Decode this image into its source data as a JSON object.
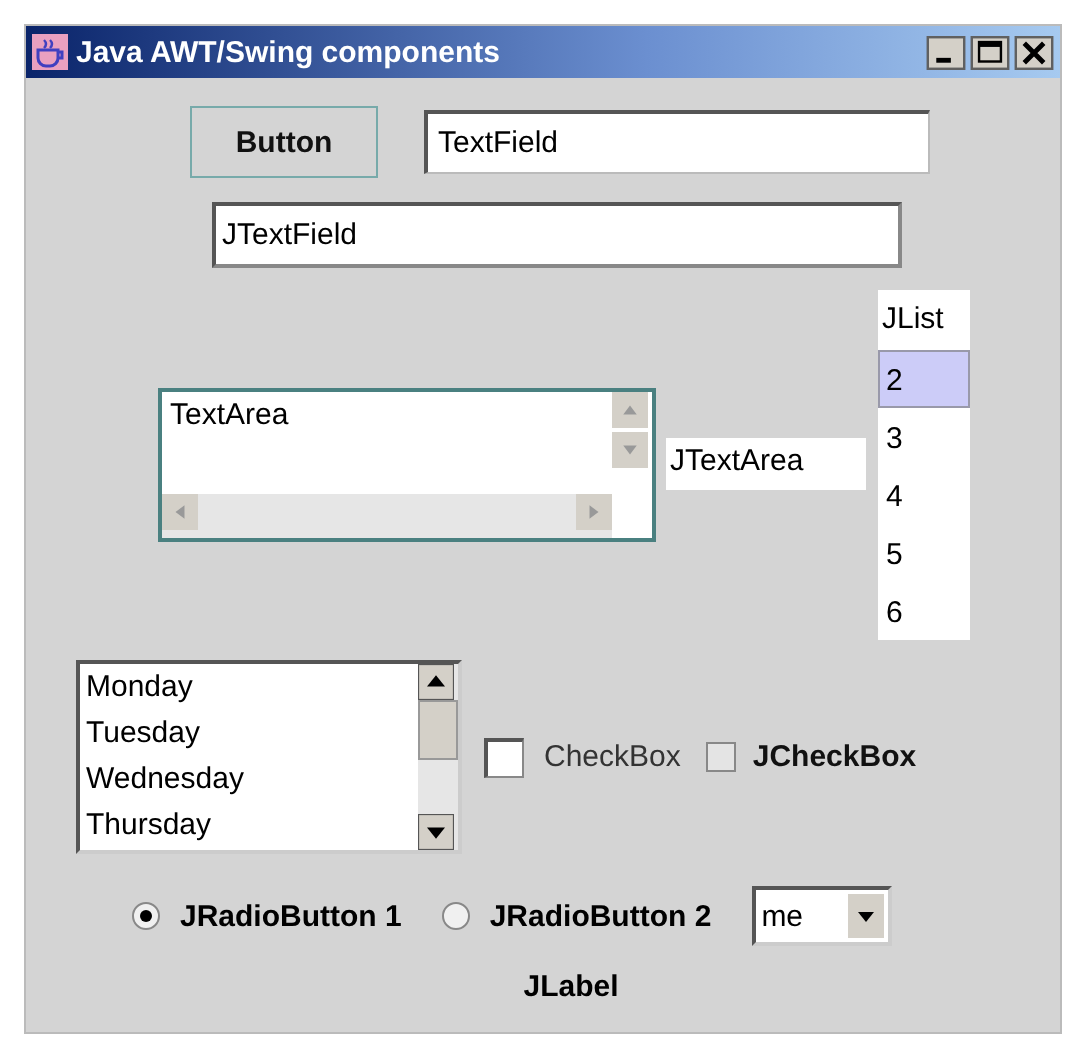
{
  "window": {
    "title": "Java AWT/Swing components"
  },
  "button": {
    "label": "Button"
  },
  "text_field": {
    "value": "TextField"
  },
  "jtext_field": {
    "value": "JTextField"
  },
  "text_area": {
    "value": "TextArea"
  },
  "jtext_area": {
    "value": "JTextArea"
  },
  "jlist": {
    "header": "JList",
    "items": [
      {
        "label": "2",
        "selected": true
      },
      {
        "label": "3",
        "selected": false
      },
      {
        "label": "4",
        "selected": false
      },
      {
        "label": "5",
        "selected": false
      },
      {
        "label": "6",
        "selected": false
      }
    ]
  },
  "day_list": {
    "items": [
      {
        "label": "Monday",
        "selected": false
      },
      {
        "label": "Tuesday",
        "selected": false
      },
      {
        "label": "Wednesday",
        "selected": false
      },
      {
        "label": "Thursday",
        "selected": false
      }
    ]
  },
  "checkboxes": [
    {
      "kind": "awt",
      "label": "CheckBox",
      "checked": false
    },
    {
      "kind": "swing",
      "label": "JCheckBox",
      "checked": false
    }
  ],
  "radios": [
    {
      "label": "JRadioButton 1",
      "selected": true
    },
    {
      "label": "JRadioButton 2",
      "selected": false
    }
  ],
  "combo": {
    "value": "me"
  },
  "label": {
    "text": "JLabel"
  }
}
